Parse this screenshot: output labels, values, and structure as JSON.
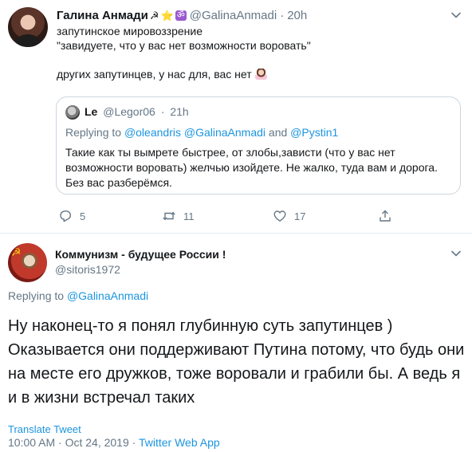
{
  "tweet1": {
    "name": "Галина Анмади",
    "emoji": [
      "☭",
      "⭐",
      "ॐ"
    ],
    "handle": "@GalinaAnmadi",
    "dot": "·",
    "time": "20h",
    "lines": [
      "запутинское мировоззрение",
      "\"завидуете, что у вас нет возможности воровать\"",
      "",
      "других запутинцев, у нас для, вас нет"
    ],
    "quote": {
      "name": "Le",
      "handle": "@Legor06",
      "dot": "·",
      "time": "21h",
      "replying_prefix": "Replying to",
      "replying_users": "@oleandris @GalinaAnmadi",
      "replying_and": "and",
      "replying_user2": "@Pystin1",
      "text": "Такие как ты вымрете быстрее, от злобы,зависти (что у вас нет возможности воровать) желчью изойдете. Не жалко, туда вам и дорога. Без вас разберёмся."
    },
    "actions": {
      "reply_count": "5",
      "retweet_count": "11",
      "like_count": "17"
    }
  },
  "tweet2": {
    "name": "Коммунизм - будущее России !",
    "handle": "@sitoris1972",
    "replying_prefix": "Replying to",
    "replying_user": "@GalinaAnmadi",
    "text": "Ну наконец-то я понял глубинную суть запутинцев ) Оказывается они поддерживают Путина потому, что будь они на месте его дружков, тоже воровали и грабили бы. А ведь я и в жизни встречал таких",
    "translate": "Translate Tweet",
    "timestamp": "10:00 AM · Oct 24, 2019",
    "dot": "·",
    "source": "Twitter Web App"
  },
  "colors": {
    "accent": "#1b95e0",
    "secondary_text": "#657786",
    "border": "#ccd6dd"
  }
}
